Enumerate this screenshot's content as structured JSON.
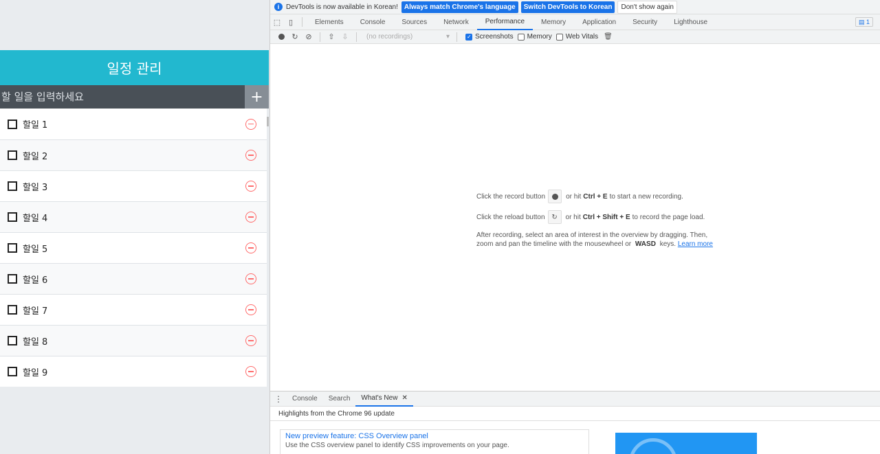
{
  "todo_app": {
    "title": "일정 관리",
    "input_placeholder": "할 일을 입력하세요",
    "add_button": "+",
    "items": [
      {
        "text": "할일 1"
      },
      {
        "text": "할일 2"
      },
      {
        "text": "할일 3"
      },
      {
        "text": "할일 4"
      },
      {
        "text": "할일 5"
      },
      {
        "text": "할일 6"
      },
      {
        "text": "할일 7"
      },
      {
        "text": "할일 8"
      },
      {
        "text": "할일 9"
      }
    ]
  },
  "devtools": {
    "infobar": {
      "message": "DevTools is now available in Korean!",
      "btn_match": "Always match Chrome's language",
      "btn_switch": "Switch DevTools to Korean",
      "btn_dismiss": "Don't show again"
    },
    "tabs": [
      "Elements",
      "Console",
      "Sources",
      "Network",
      "Performance",
      "Memory",
      "Application",
      "Security",
      "Lighthouse"
    ],
    "active_tab": "Performance",
    "issues_count": "1",
    "perf_toolbar": {
      "recordings": "(no recordings)",
      "screenshots": "Screenshots",
      "memory": "Memory",
      "web_vitals": "Web Vitals"
    },
    "landing": {
      "record_pre": "Click the record button",
      "record_mid": "or hit",
      "record_key": "Ctrl + E",
      "record_post": "to start a new recording.",
      "reload_pre": "Click the reload button",
      "reload_mid": "or hit",
      "reload_key": "Ctrl + Shift + E",
      "reload_post": "to record the page load.",
      "after_1": "After recording, select an area of interest in the overview by dragging. Then,",
      "after_2": "zoom and pan the timeline with the mousewheel or",
      "after_key": "WASD",
      "after_3": "keys.",
      "learn_more": "Learn more"
    },
    "drawer": {
      "tabs": [
        "Console",
        "Search",
        "What's New"
      ],
      "highlights": "Highlights from the Chrome 96 update",
      "card_title": "New preview feature: CSS Overview panel",
      "card_desc": "Use the CSS overview panel to identify CSS improvements on your page."
    }
  }
}
